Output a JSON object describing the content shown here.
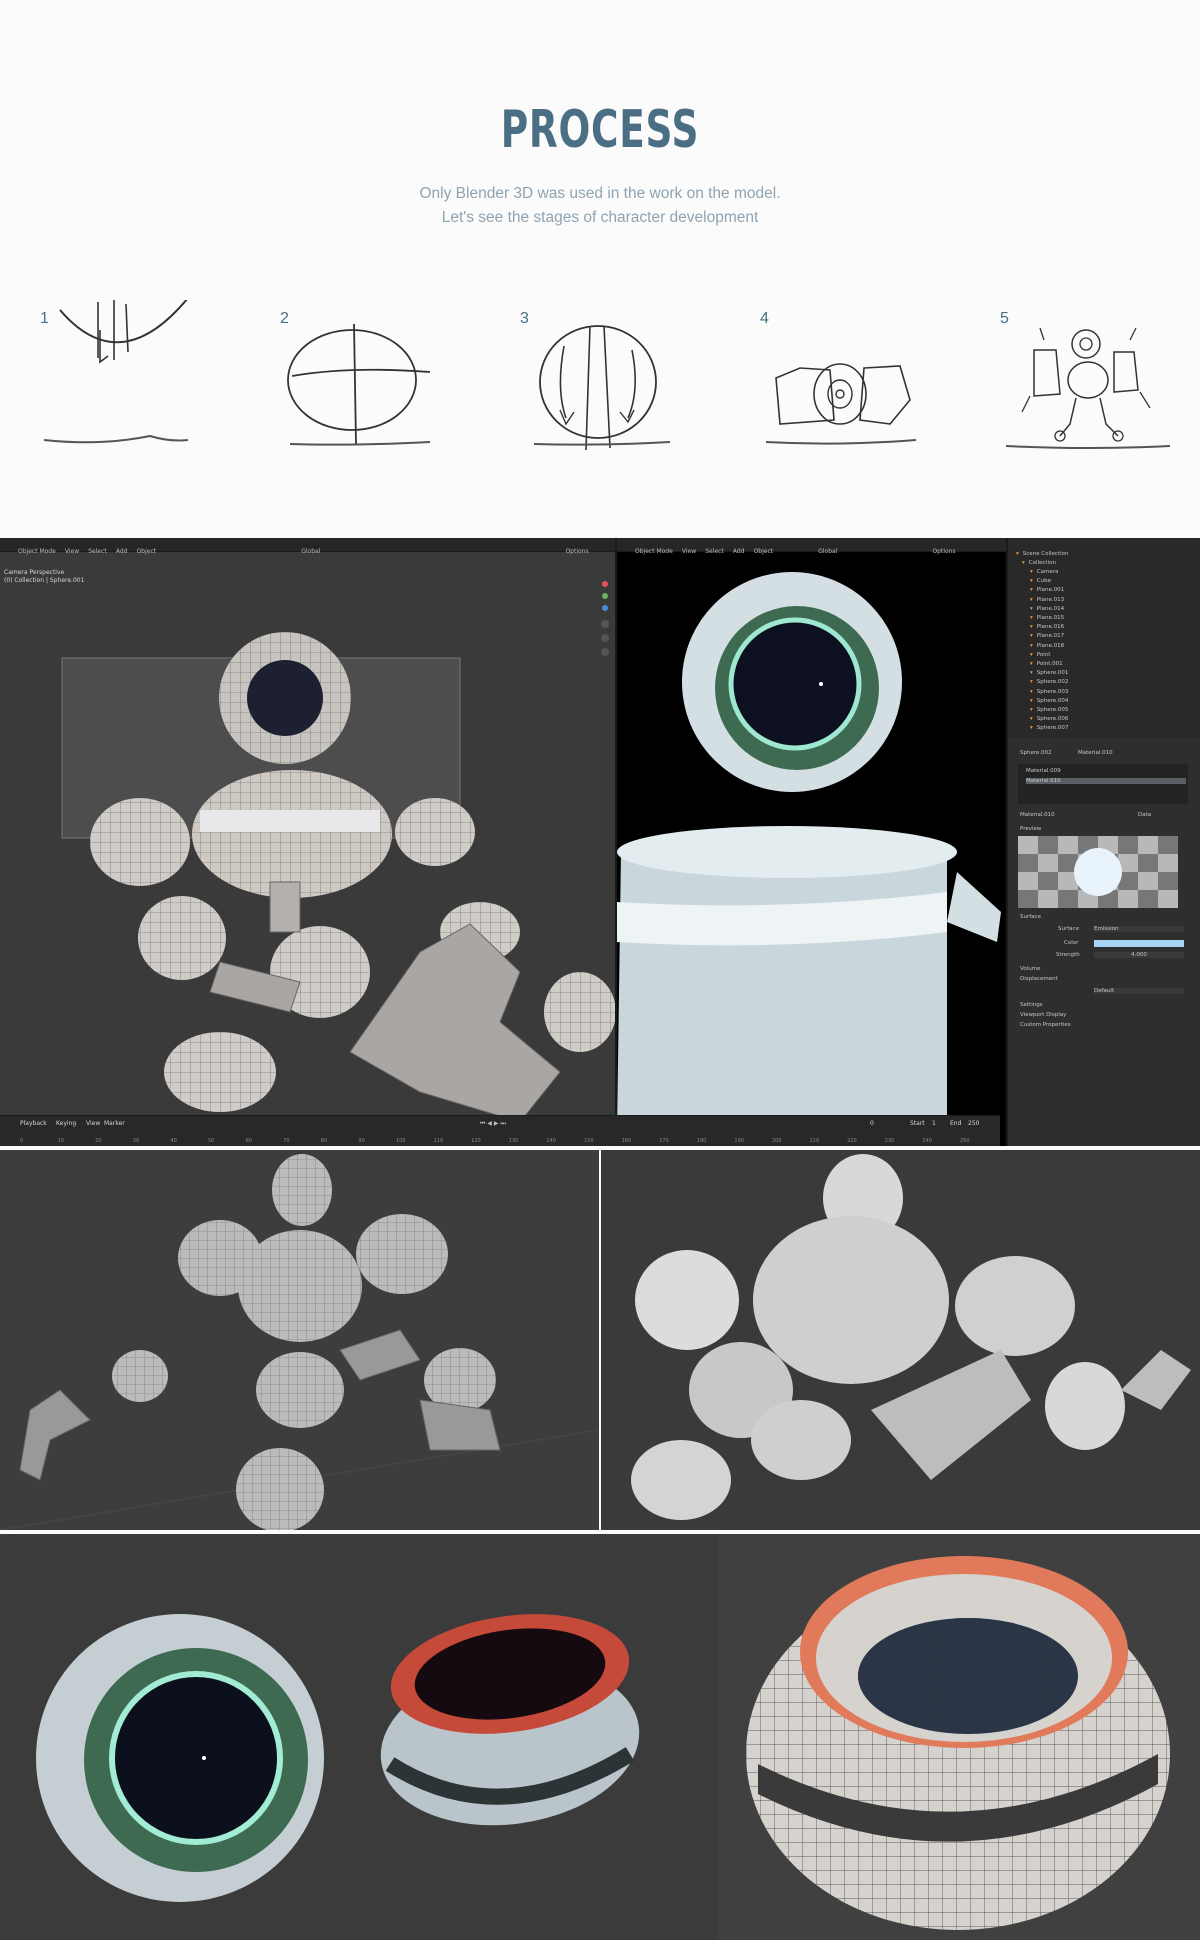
{
  "header": {
    "title": "PROCESS",
    "subtitle_line1": "Only Blender 3D was used in the work on the model.",
    "subtitle_line2": "Let's see the stages of character development"
  },
  "steps": [
    {
      "number": "1"
    },
    {
      "number": "2"
    },
    {
      "number": "3"
    },
    {
      "number": "4"
    },
    {
      "number": "5"
    }
  ],
  "blender": {
    "left_viewport": {
      "mode": "Object Mode",
      "menu": [
        "View",
        "Select",
        "Add",
        "Object"
      ],
      "orientation": "Global",
      "options": "Options",
      "info_line1": "Camera Perspective",
      "info_line2": "(0) Collection | Sphere.001"
    },
    "right_viewport": {
      "mode": "Object Mode",
      "menu": [
        "View",
        "Select",
        "Add",
        "Object"
      ],
      "orientation": "Global",
      "options": "Options"
    },
    "outliner": {
      "root": "Scene Collection",
      "collection": "Collection",
      "items": [
        "Camera",
        "Cube",
        "Plane.001",
        "Plane.013",
        "Plane.014",
        "Plane.015",
        "Plane.016",
        "Plane.017",
        "Plane.018",
        "Point",
        "Point.001",
        "Sphere.001",
        "Sphere.002",
        "Sphere.003",
        "Sphere.004",
        "Sphere.005",
        "Sphere.006",
        "Sphere.007"
      ]
    },
    "properties": {
      "object": "Sphere.002",
      "material_tab": "Material.010",
      "slots": [
        "Material.009",
        "Material.010"
      ],
      "material_name": "Material.010",
      "data": "Data",
      "preview": "Preview",
      "surface": "Surface",
      "surface_value": "Emission",
      "color_label": "Color",
      "strength_label": "Strength",
      "strength_value": "4.000",
      "volume": "Volume",
      "displacement": "Displacement",
      "displacement_value": "Default",
      "settings": "Settings",
      "viewport_display": "Viewport Display",
      "custom_properties": "Custom Properties"
    },
    "timeline": {
      "playback": "Playback",
      "keying": "Keying",
      "view": "View",
      "marker": "Marker",
      "start_label": "Start",
      "start": "1",
      "end_label": "End",
      "end": "250",
      "current": "0",
      "ticks": [
        "0",
        "10",
        "20",
        "30",
        "40",
        "50",
        "60",
        "70",
        "80",
        "90",
        "100",
        "110",
        "120",
        "130",
        "140",
        "150",
        "160",
        "170",
        "180",
        "190",
        "200",
        "210",
        "220",
        "230",
        "240",
        "250"
      ]
    }
  },
  "colors": {
    "title": "#4a6e84",
    "subtitle": "#8fa3b0",
    "emission_color": "#a8d4f5",
    "accent_orange": "#e07a5a",
    "ring_green": "#7ee0c0"
  }
}
